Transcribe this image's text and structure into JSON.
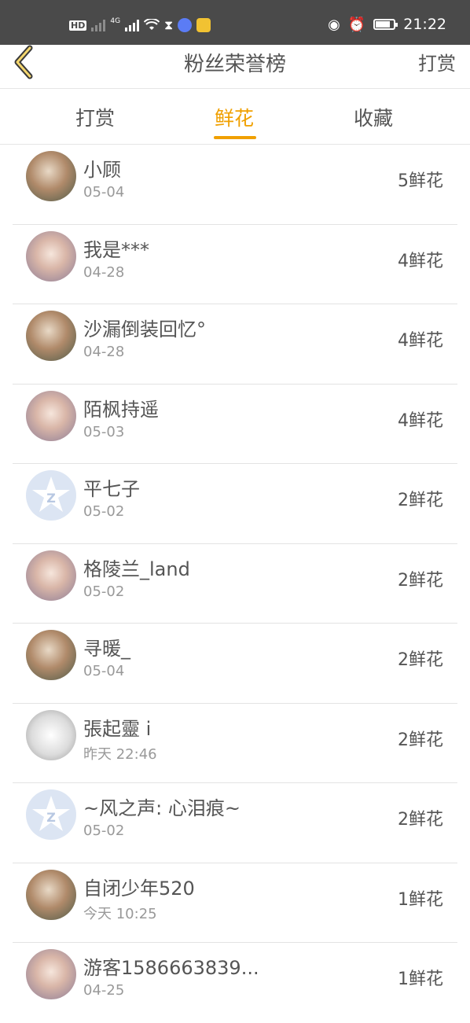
{
  "status_bar": {
    "left_indicators": [
      "HD",
      "4G"
    ],
    "time": "21:22",
    "battery_fraction": 0.8,
    "icons": [
      "hd-icon",
      "signal-icon",
      "signal-4g-icon",
      "wifi-icon",
      "hourglass-icon",
      "music-app-icon",
      "video-app-icon",
      "eye-icon",
      "alarm-icon",
      "battery-icon"
    ]
  },
  "nav": {
    "title": "粉丝荣誉榜",
    "right_label": "打赏",
    "back_icon": "chevron-left-icon"
  },
  "tabs": [
    {
      "label": "打赏",
      "active": false
    },
    {
      "label": "鲜花",
      "active": true
    },
    {
      "label": "收藏",
      "active": false
    }
  ],
  "colors": {
    "accent": "#f0a000",
    "status_bar_bg": "#4a4a4a",
    "text": "#555555",
    "subtext": "#999999"
  },
  "fans": [
    {
      "name": "小顾",
      "date": "05-04",
      "count": "5鲜花",
      "avatar": "photo"
    },
    {
      "name": "我是***",
      "date": "04-28",
      "count": "4鲜花",
      "avatar": "anime"
    },
    {
      "name": "沙漏倒装回忆°",
      "date": "04-28",
      "count": "4鲜花",
      "avatar": "photo"
    },
    {
      "name": "陌枫持遥",
      "date": "05-03",
      "count": "4鲜花",
      "avatar": "anime"
    },
    {
      "name": "平七子",
      "date": "05-02",
      "count": "2鲜花",
      "avatar": "default"
    },
    {
      "name": "格陵兰_land",
      "date": "05-02",
      "count": "2鲜花",
      "avatar": "anime"
    },
    {
      "name": "寻暖_",
      "date": "05-04",
      "count": "2鲜花",
      "avatar": "photo"
    },
    {
      "name": "張起靈 i",
      "date": "昨天 22:46",
      "count": "2鲜花",
      "avatar": "sketch"
    },
    {
      "name": "~风之声: 心泪痕~",
      "date": "05-02",
      "count": "2鲜花",
      "avatar": "default"
    },
    {
      "name": "自闭少年520",
      "date": "今天 10:25",
      "count": "1鲜花",
      "avatar": "photo"
    },
    {
      "name": "游客1586663839...",
      "date": "04-25",
      "count": "1鲜花",
      "avatar": "anime"
    }
  ]
}
